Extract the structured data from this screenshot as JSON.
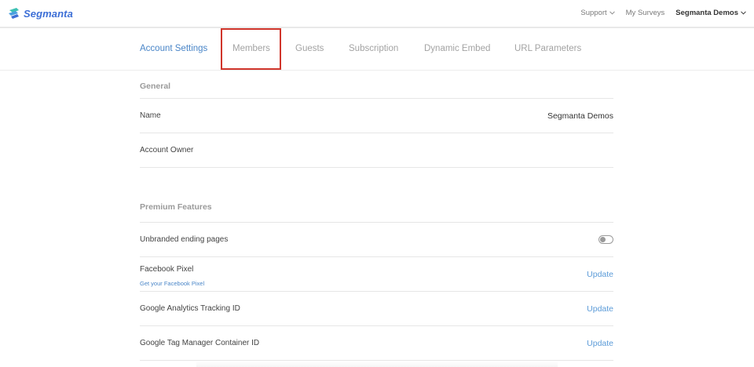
{
  "brand": {
    "name": "Segmanta",
    "accent": "#3d6fd6"
  },
  "topnav": {
    "support": "Support",
    "my_surveys": "My Surveys",
    "account": "Segmanta Demos"
  },
  "tabs": [
    {
      "label": "Account Settings",
      "active": true
    },
    {
      "label": "Members",
      "active": false,
      "highlighted": true
    },
    {
      "label": "Guests",
      "active": false
    },
    {
      "label": "Subscription",
      "active": false
    },
    {
      "label": "Dynamic Embed",
      "active": false
    },
    {
      "label": "URL Parameters",
      "active": false
    }
  ],
  "general": {
    "title": "General",
    "name_label": "Name",
    "name_value": "Segmanta Demos",
    "owner_label": "Account Owner",
    "owner_value": ""
  },
  "premium": {
    "title": "Premium Features",
    "unbranded_label": "Unbranded ending pages",
    "unbranded_enabled": false,
    "facebook_label": "Facebook Pixel",
    "facebook_sub": "Get your Facebook Pixel",
    "facebook_action": "Update",
    "ga_label": "Google Analytics Tracking ID",
    "ga_action": "Update",
    "gtm_label": "Google Tag Manager Container ID",
    "gtm_action": "Update"
  },
  "colors": {
    "active_tab": "#4a86c8",
    "link": "#5b9bd8",
    "highlight_border": "#d0352b"
  }
}
